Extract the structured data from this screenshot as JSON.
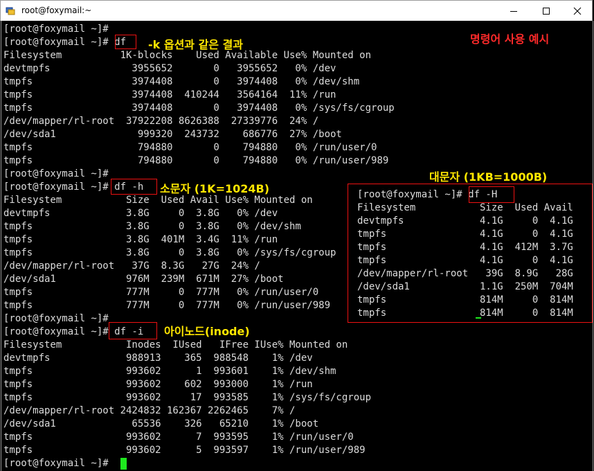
{
  "window": {
    "title": "root@foxymail:~",
    "icons": [
      "terminal-app-icon",
      "minimize-icon",
      "maximize-icon",
      "close-icon"
    ]
  },
  "colors": {
    "annotation_yellow": "#ffe600",
    "annotation_red": "#ff2a2a",
    "box_red": "#e11111",
    "cursor_green": "#1ee81e",
    "terminal_text": "#dcdcdc"
  },
  "terminal": {
    "lines": [
      "[root@foxymail ~]#",
      "[root@foxymail ~]# df",
      "Filesystem          1K-blocks    Used Available Use% Mounted on",
      "devtmpfs              3955652       0   3955652   0% /dev",
      "tmpfs                 3974408       0   3974408   0% /dev/shm",
      "tmpfs                 3974408  410244   3564164  11% /run",
      "tmpfs                 3974408       0   3974408   0% /sys/fs/cgroup",
      "/dev/mapper/rl-root  37922208 8626388  27339776  24% /",
      "/dev/sda1              999320  243732    686776  27% /boot",
      "tmpfs                  794880       0    794880   0% /run/user/0",
      "tmpfs                  794880       0    794880   0% /run/user/989",
      "[root@foxymail ~]#",
      "[root@foxymail ~]# df -h",
      "Filesystem           Size  Used Avail Use% Mounted on",
      "devtmpfs             3.8G     0  3.8G   0% /dev",
      "tmpfs                3.8G     0  3.8G   0% /dev/shm",
      "tmpfs                3.8G  401M  3.4G  11% /run",
      "tmpfs                3.8G     0  3.8G   0% /sys/fs/cgroup",
      "/dev/mapper/rl-root   37G  8.3G   27G  24% /",
      "/dev/sda1            976M  239M  671M  27% /boot",
      "tmpfs                777M     0  777M   0% /run/user/0",
      "tmpfs                777M     0  777M   0% /run/user/989",
      "[root@foxymail ~]#",
      "[root@foxymail ~]# df -i",
      "Filesystem           Inodes  IUsed   IFree IUse% Mounted on",
      "devtmpfs             988913    365  988548    1% /dev",
      "tmpfs                993602      1  993601    1% /dev/shm",
      "tmpfs                993602    602  993000    1% /run",
      "tmpfs                993602     17  993585    1% /sys/fs/cgroup",
      "/dev/mapper/rl-root 2424832 162367 2262465    7% /",
      "/dev/sda1             65536    326   65210    1% /boot",
      "tmpfs                993602      7  993595    1% /run/user/0",
      "tmpfs                993602      5  993597    1% /run/user/989",
      "[root@foxymail ~]#"
    ],
    "panel_lines": [
      "[root@foxymail ~]# df -H",
      "Filesystem           Size  Used Avail",
      "devtmpfs             4.1G     0  4.1G",
      "tmpfs                4.1G     0  4.1G",
      "tmpfs                4.1G  412M  3.7G",
      "tmpfs                4.1G     0  4.1G",
      "/dev/mapper/rl-root   39G  8.9G   28G",
      "/dev/sda1            1.1G  250M  704M",
      "tmpfs                814M     0  814M",
      "tmpfs                814M     0  814M"
    ]
  },
  "annotations": {
    "usage_example": "명령어 사용 예시",
    "df_note": "-k 옵션과 같은 결과",
    "df_h_note": "소문자 (1K=1024B)",
    "df_H_note": "대문자 (1KB=1000B)",
    "df_i_note": "아이노드(inode)"
  }
}
